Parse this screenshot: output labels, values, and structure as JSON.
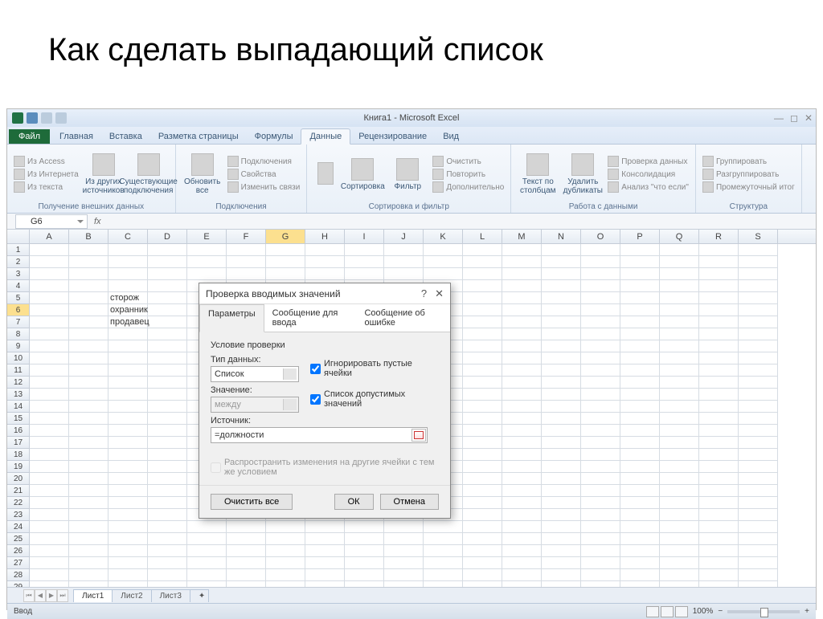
{
  "slide_title": "Как сделать выпадающий список",
  "window_title": "Книга1 - Microsoft Excel",
  "ribbon": {
    "file": "Файл",
    "tabs": [
      "Главная",
      "Вставка",
      "Разметка страницы",
      "Формулы",
      "Данные",
      "Рецензирование",
      "Вид"
    ],
    "active_tab": "Данные",
    "groups": {
      "external": {
        "items": [
          "Из Access",
          "Из Интернета",
          "Из текста"
        ],
        "btn1": "Из других источников",
        "btn2": "Существующие подключения",
        "title": "Получение внешних данных"
      },
      "connections": {
        "btn": "Обновить все",
        "items": [
          "Подключения",
          "Свойства",
          "Изменить связи"
        ],
        "title": "Подключения"
      },
      "sort": {
        "btn1": "Сортировка",
        "btn2": "Фильтр",
        "items": [
          "Очистить",
          "Повторить",
          "Дополнительно"
        ],
        "title": "Сортировка и фильтр"
      },
      "tools": {
        "btn1": "Текст по столбцам",
        "btn2": "Удалить дубликаты",
        "items": [
          "Проверка данных",
          "Консолидация",
          "Анализ \"что если\""
        ],
        "title": "Работа с данными"
      },
      "outline": {
        "items": [
          "Группировать",
          "Разгруппировать",
          "Промежуточный итог"
        ],
        "title": "Структура"
      }
    }
  },
  "name_box": "G6",
  "columns": [
    "A",
    "B",
    "C",
    "D",
    "E",
    "F",
    "G",
    "H",
    "I",
    "J",
    "K",
    "L",
    "M",
    "N",
    "O",
    "P",
    "Q",
    "R",
    "S"
  ],
  "active_col": "G",
  "active_row": 6,
  "cells": {
    "C5": "сторож",
    "C6": "охранник",
    "C7": "продавец"
  },
  "dialog": {
    "title": "Проверка вводимых значений",
    "tabs": [
      "Параметры",
      "Сообщение для ввода",
      "Сообщение об ошибке"
    ],
    "section": "Условие проверки",
    "type_label": "Тип данных:",
    "type_value": "Список",
    "value_label": "Значение:",
    "value_value": "между",
    "ignore_blank": "Игнорировать пустые ячейки",
    "dropdown_list": "Список допустимых значений",
    "source_label": "Источник:",
    "source_value": "=должности",
    "spread": "Распространить изменения на другие ячейки с тем же условием",
    "clear": "Очистить все",
    "ok": "ОК",
    "cancel": "Отмена"
  },
  "sheets": [
    "Лист1",
    "Лист2",
    "Лист3"
  ],
  "status": "Ввод",
  "zoom": "100%"
}
